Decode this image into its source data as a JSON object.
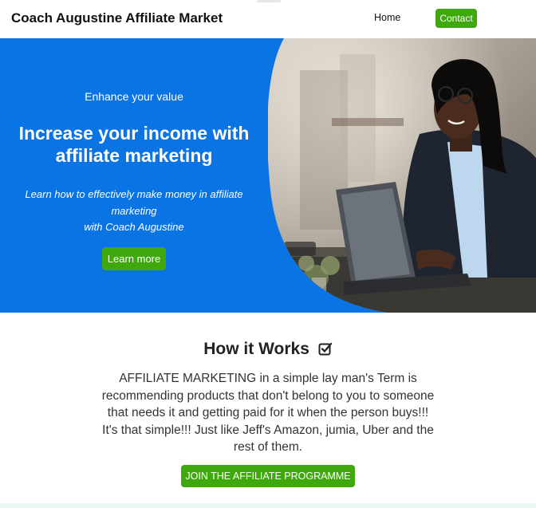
{
  "navbar": {
    "brand": "Coach Augustine Affiliate Market",
    "links": [
      {
        "label": "Home"
      },
      {
        "label": "Contact"
      }
    ],
    "accent_color": "#3ea80c"
  },
  "hero": {
    "kicker": "Enhance your value",
    "headline": "Increase your income with affiliate marketing",
    "lede_line1": "Learn how to effectively make money in affiliate marketing",
    "lede_line2": "with Coach Augustine",
    "cta_label": "Learn more",
    "background_color": "#0b74e4",
    "image": "photo-smiling-woman-at-laptop"
  },
  "how_it_works": {
    "title": "How it Works",
    "title_icon": "checkbox-icon",
    "body": "AFFILIATE MARKETING in a simple lay man's Term is recommending products that don't belong to you to someone that needs it and getting paid for it when the person buys!!! It's that simple!!! Just like Jeff's Amazon, jumia, Uber and the rest of them.",
    "cta_label": "JOIN THE AFFILIATE PROGRAMME"
  }
}
